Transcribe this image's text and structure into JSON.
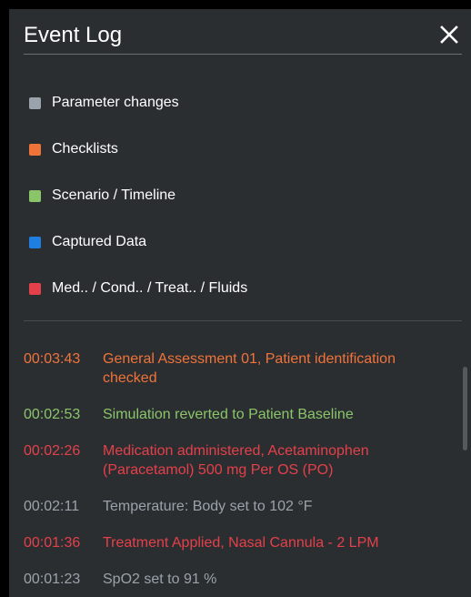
{
  "header": {
    "title": "Event Log",
    "close_icon": "close-icon"
  },
  "colors": {
    "parameter": "#9aa2ab",
    "checklist": "#f0733a",
    "scenario": "#8bc56a",
    "captured": "#1f7fe0",
    "medication": "#e4404a"
  },
  "legend": [
    {
      "label": "Parameter changes",
      "color": "#9aa2ab"
    },
    {
      "label": "Checklists",
      "color": "#f0733a"
    },
    {
      "label": "Scenario / Timeline",
      "color": "#8bc56a"
    },
    {
      "label": "Captured Data",
      "color": "#1f7fe0"
    },
    {
      "label": "Med.. / Cond.. / Treat.. / Fluids",
      "color": "#e4404a"
    }
  ],
  "log": [
    {
      "time": "00:03:43",
      "text": "General Assessment 01, Patient identification checked",
      "category": "checklist"
    },
    {
      "time": "00:02:53",
      "text": "Simulation reverted to Patient Baseline",
      "category": "scenario"
    },
    {
      "time": "00:02:26",
      "text": "Medication administered, Acetaminophen (Paracetamol) 500 mg Per OS (PO)",
      "category": "medication"
    },
    {
      "time": "00:02:11",
      "text": "Temperature: Body set to 102 °F",
      "category": "parameter"
    },
    {
      "time": "00:01:36",
      "text": "Treatment Applied, Nasal Cannula - 2 LPM",
      "category": "medication"
    },
    {
      "time": "00:01:23",
      "text": "SpO2 set to 91 %",
      "category": "parameter"
    }
  ]
}
